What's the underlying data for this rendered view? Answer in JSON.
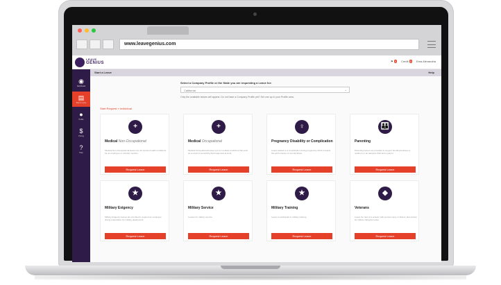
{
  "browser": {
    "url": "www.leavegenius.com",
    "dot_colors": [
      "#ff5f57",
      "#febc2e",
      "#28c840"
    ]
  },
  "header": {
    "logo_line1": "LEAVE",
    "logo_line2": "GENIUS",
    "right_items": [
      "Credit",
      "Ema Alexandria"
    ],
    "badge1": "0",
    "badge2": "0"
  },
  "sidebar": {
    "items": [
      {
        "icon": "dashboard-icon",
        "glyph": "◉",
        "label": "Dashboard"
      },
      {
        "icon": "document-icon",
        "glyph": "▤",
        "label": "Start a Leave"
      },
      {
        "icon": "person-icon",
        "glyph": "●",
        "label": "Profile"
      },
      {
        "icon": "dollar-icon",
        "glyph": "$",
        "label": "Pricing"
      },
      {
        "icon": "help-icon",
        "glyph": "?",
        "label": "Help"
      }
    ]
  },
  "titlebar": {
    "title": "Start a Leave",
    "help": "Help"
  },
  "company": {
    "label": "Select a Company Profile or the State you are requesting a Leave for:",
    "value": "California",
    "help": "Only the available leaves will appear. Do not have a Company Profile yet? Set one up in your Profile area.",
    "help_link": "Profile"
  },
  "breadcrumb": "Start Request  »  Individual",
  "cards": [
    {
      "glyph": "+",
      "icon": "medical-plus-icon",
      "title": "Medical",
      "subtitle": "Non-Occupational",
      "desc": "Medical Non-Occupational leaves are for serious health conditions for an employee or a family member.",
      "button": "Request Leave"
    },
    {
      "glyph": "+",
      "icon": "medical-plus-icon",
      "title": "Medical",
      "subtitle": "Occupational",
      "desc": "Medical Occupational leaves are for medical conditions that exist as a result of something that happened at work.",
      "button": "Request Leave"
    },
    {
      "glyph": "♀",
      "icon": "pregnancy-icon",
      "title": "Pregnancy Disability or Complication",
      "subtitle": "",
      "desc": "Leave related to a complication during pregnancy which impacts the performance of normal duties.",
      "button": "Request Leave"
    },
    {
      "glyph": "👪",
      "icon": "parenting-icon",
      "title": "Parenting",
      "subtitle": "",
      "desc": "Parenting leaves are provided to support bonding between a newborn or an adopted child and a parent.",
      "button": "Request Leave"
    },
    {
      "glyph": "★",
      "icon": "military-star-icon",
      "title": "Military Exigency",
      "subtitle": "",
      "desc": "Military Exigency leaves are provided to support an employee during preparation for military deployment.",
      "button": "Request Leave"
    },
    {
      "glyph": "★",
      "icon": "military-star-icon",
      "title": "Military Service",
      "subtitle": "",
      "desc": "Leaves for military service.",
      "button": "Request Leave"
    },
    {
      "glyph": "★",
      "icon": "military-star-icon",
      "title": "Military Training",
      "subtitle": "",
      "desc": "Leave to participate in military training.",
      "button": "Request Leave"
    },
    {
      "glyph": "◆",
      "icon": "veteran-icon",
      "title": "Veterans",
      "subtitle": "",
      "desc": "Leave for care of a veteran with serious injury or illness; also known as military caregiver leave.",
      "button": "Request Leave"
    }
  ],
  "colors": {
    "accent": "#e5402a",
    "brand": "#2f1b47"
  }
}
